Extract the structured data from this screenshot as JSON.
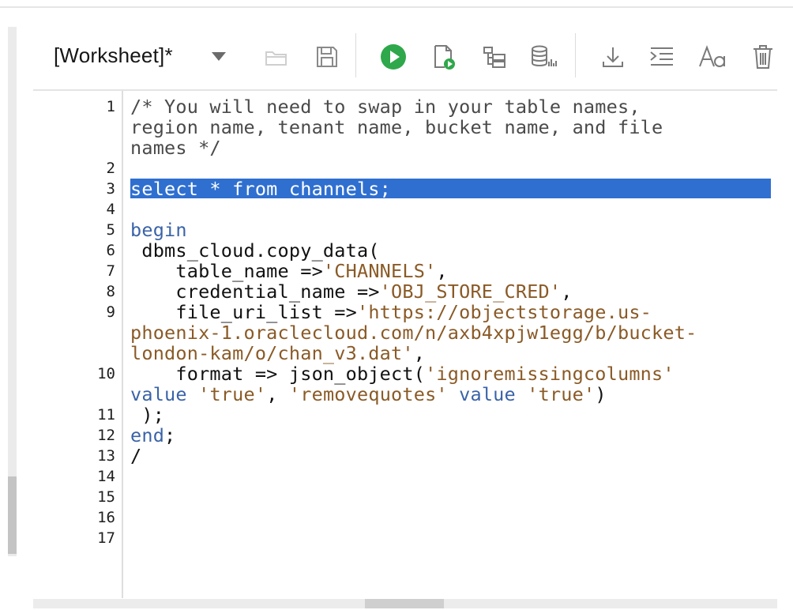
{
  "worksheet": {
    "title": "[Worksheet]*"
  },
  "toolbar": {
    "icons": [
      "open-folder-icon",
      "save-icon",
      "run-statement-icon",
      "run-script-icon",
      "explain-plan-icon",
      "autotrace-icon",
      "download-icon",
      "format-icon",
      "font-case-icon",
      "delete-icon"
    ],
    "run_color": "#2ea84a"
  },
  "editor": {
    "line_numbers": [
      "1",
      "2",
      "3",
      "4",
      "5",
      "6",
      "7",
      "8",
      "9",
      "10",
      "11",
      "12",
      "13",
      "14",
      "15",
      "16",
      "17"
    ],
    "code": {
      "l1a": "/* You will need to swap in your table names,",
      "l1b": "region name, tenant name, bucket name, and file",
      "l1c": "names */",
      "l3": "select * from channels;",
      "l5": "begin",
      "l6": " dbms_cloud.copy_data(",
      "l7a": "    table_name =>",
      "l7b": "'CHANNELS'",
      "l7c": ",",
      "l8a": "    credential_name =>",
      "l8b": "'OBJ_STORE_CRED'",
      "l8c": ",",
      "l9a": "    file_uri_list =>",
      "l9b": "'https://objectstorage.us-",
      "l9c": "phoenix-1.oraclecloud.com/n/axb4xpjw1egg/b/bucket-",
      "l9d": "london-kam/o/chan_v3.dat'",
      "l9e": ",",
      "l10a": "    format => json_object(",
      "l10b": "'ignoremissingcolumns'",
      "l10c": "value",
      "l10d": "'true'",
      "l10e": ", ",
      "l10f": "'removequotes'",
      "l10g": "value",
      "l10h": "'true'",
      "l10i": ")",
      "l11": " );",
      "l12a": "end",
      "l12b": ";",
      "l13": "/"
    },
    "highlight_color": "#2f6fd0"
  }
}
